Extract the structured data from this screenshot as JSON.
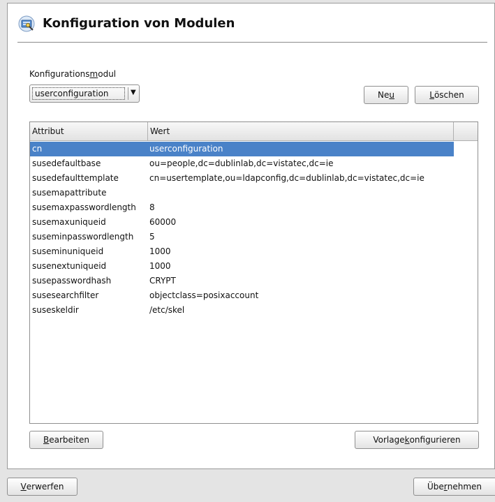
{
  "header": {
    "title": "Konfiguration von Modulen"
  },
  "module": {
    "label_pre": "Konfigurations",
    "label_ul": "m",
    "label_post": "odul",
    "selected": "userconfiguration"
  },
  "buttons": {
    "neu": {
      "pre": "Ne",
      "ul": "u",
      "post": ""
    },
    "loeschen": {
      "pre": "",
      "ul": "L",
      "post": "öschen"
    },
    "bearbeiten": {
      "pre": "",
      "ul": "B",
      "post": "earbeiten"
    },
    "vorlage": {
      "pre": "Vorlage ",
      "ul": "k",
      "post": "onfigurieren"
    },
    "verwerfen": {
      "pre": "",
      "ul": "V",
      "post": "erwerfen"
    },
    "uebernehmen": {
      "pre": "Übe",
      "ul": "r",
      "post": "nehmen"
    }
  },
  "table": {
    "columns": [
      "Attribut",
      "Wert"
    ],
    "rows": [
      {
        "attr": "cn",
        "value": "userconfiguration"
      },
      {
        "attr": "susedefaultbase",
        "value": "ou=people,dc=dublinlab,dc=vistatec,dc=ie"
      },
      {
        "attr": "susedefaulttemplate",
        "value": "cn=usertemplate,ou=ldapconfig,dc=dublinlab,dc=vistatec,dc=ie"
      },
      {
        "attr": "susemapattribute",
        "value": ""
      },
      {
        "attr": "susemaxpasswordlength",
        "value": "8"
      },
      {
        "attr": "susemaxuniqueid",
        "value": "60000"
      },
      {
        "attr": "suseminpasswordlength",
        "value": "5"
      },
      {
        "attr": "suseminuniqueid",
        "value": "1000"
      },
      {
        "attr": "susenextuniqueid",
        "value": "1000"
      },
      {
        "attr": "susepasswordhash",
        "value": "CRYPT"
      },
      {
        "attr": "susesearchfilter",
        "value": "objectclass=posixaccount"
      },
      {
        "attr": "suseskeldir",
        "value": "/etc/skel"
      }
    ]
  },
  "colors": {
    "selection": "#4a82c8"
  },
  "icons": {
    "header": "ldap-module-config-icon",
    "combo": "dropdown-arrow-icon"
  }
}
